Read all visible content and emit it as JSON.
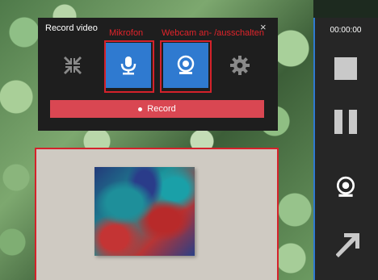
{
  "panel": {
    "title": "Record video",
    "close_glyph": "×",
    "record_label": "Record"
  },
  "annotations": {
    "microphone": "Mikrofon",
    "webcam": "Webcam an- /ausschalten"
  },
  "sidebar": {
    "timer": "00:00:00"
  },
  "icons": {
    "minimize": "compress-arrows-icon",
    "microphone": "microphone-icon",
    "webcam": "webcam-icon",
    "settings": "gear-icon",
    "stop": "stop-icon",
    "pause": "pause-icon",
    "sidebar_webcam": "webcam-icon",
    "expand": "arrow-diagonal-icon"
  },
  "colors": {
    "accent_blue": "#2f7ad0",
    "record_red": "#d94752",
    "annotation_red": "#d4222b"
  }
}
